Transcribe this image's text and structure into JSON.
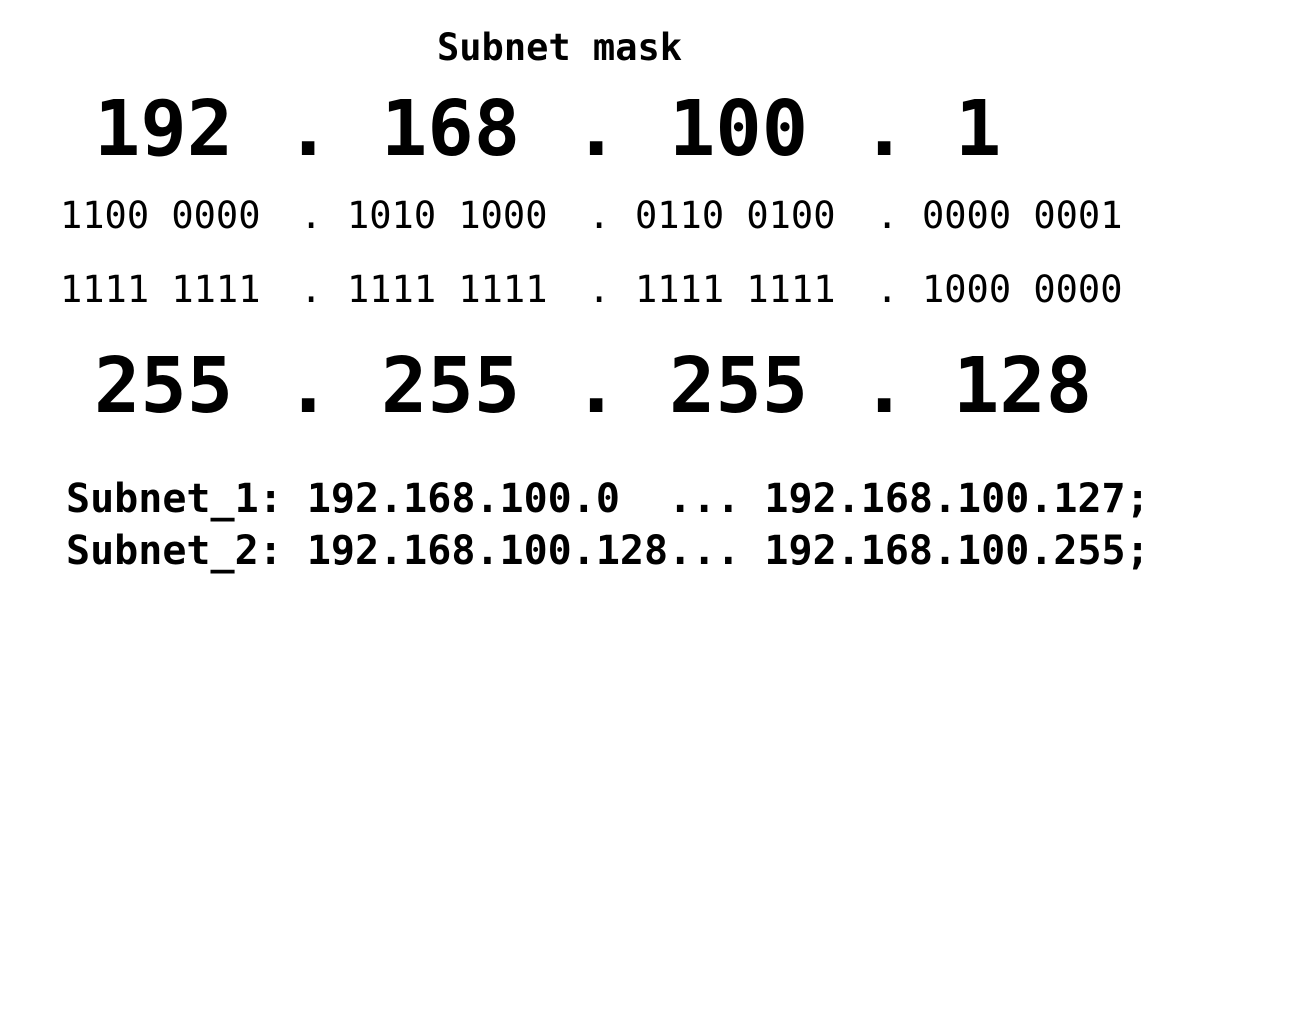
{
  "title": "Subnet mask",
  "ip_address": {
    "octets": [
      "192",
      "168",
      "100",
      "1"
    ],
    "separator": "."
  },
  "ip_binary": {
    "octets": [
      "1100 0000",
      "1010 1000",
      "0110 0100",
      "0000 0001"
    ],
    "separator": "."
  },
  "mask_binary": {
    "octets": [
      "1111 1111",
      "1111 1111",
      "1111 1111",
      "1000 0000"
    ],
    "separator": "."
  },
  "mask_decimal": {
    "octets": [
      "255",
      "255",
      "255",
      "128"
    ],
    "separator": "."
  },
  "subnets": [
    {
      "label": "Subnet_1:",
      "range": "192.168.100.0  ... 192.168.100.127;"
    },
    {
      "label": "Subnet_2:",
      "range": "192.168.100.128... 192.168.100.255;"
    }
  ]
}
